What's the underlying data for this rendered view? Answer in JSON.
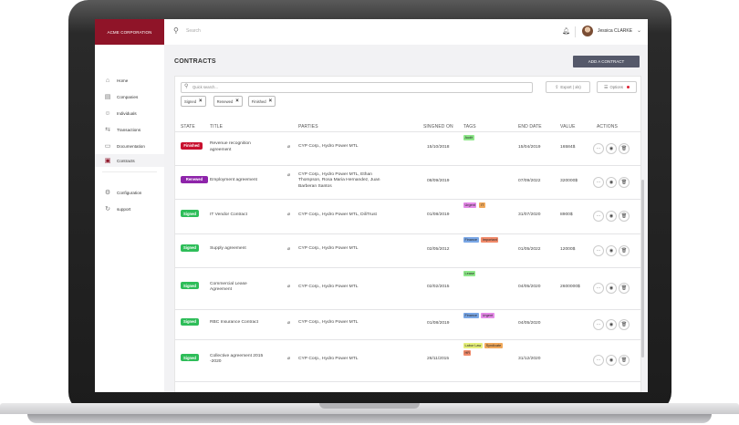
{
  "brand": "ACME CORPORATION",
  "sidebar": {
    "items": [
      {
        "label": "Home",
        "icon": "home-icon",
        "glyph": "⌂"
      },
      {
        "label": "Companies",
        "icon": "building-icon",
        "glyph": "▤"
      },
      {
        "label": "Individuals",
        "icon": "people-icon",
        "glyph": "☺"
      },
      {
        "label": "Transactions",
        "icon": "exchange-icon",
        "glyph": "⇆"
      },
      {
        "label": "Documentation",
        "icon": "folder-icon",
        "glyph": "▭"
      },
      {
        "label": "Contracts",
        "icon": "contract-icon",
        "glyph": "▣"
      }
    ],
    "bottom": [
      {
        "label": "Configuration",
        "icon": "gears-icon",
        "glyph": "⚙"
      },
      {
        "label": "support",
        "icon": "support-icon",
        "glyph": "↻"
      }
    ]
  },
  "topbar": {
    "search_placeholder": "Search",
    "user_name": "Jessica CLARKE"
  },
  "page": {
    "title": "CONTRACTS",
    "add_button": "ADD A CONTRACT"
  },
  "filters": {
    "search_placeholder": "Quick search...",
    "export_label": "Export ( xls)",
    "options_label": "Options",
    "chips": [
      "Signed",
      "Renewed",
      "Finished"
    ]
  },
  "columns": {
    "state": "STATE",
    "title": "TITLE",
    "parties": "PARTIES",
    "signed_on": "SINGNED ON",
    "tags": "TAGS",
    "end_date": "END DATE",
    "value": "VALUE",
    "actions": "ACTIONS"
  },
  "colors": {
    "brand": "#8f1428",
    "finished": "#c8102e",
    "renewed": "#8e24aa",
    "signed": "#2ebd59",
    "button": "#55596a"
  },
  "rows": [
    {
      "state": "Finished",
      "title": [
        "Revenue recognition",
        "agreement"
      ],
      "parties": [
        "CYP Corp., Hydro Power MTL"
      ],
      "signed_on": "15/10/2018",
      "tags": [
        {
          "t": "Audit",
          "c": "#8ee88a"
        }
      ],
      "end_date": "15/04/2019",
      "value": "16584$"
    },
    {
      "state": "Renewed",
      "title": [
        "Employment agreement"
      ],
      "parties": [
        "CYP Corp., Hydro Power MTL, Ethan",
        "Thompson, Rosa Maria Hernandez, Juan",
        "Barberan Santos"
      ],
      "signed_on": "08/09/2019",
      "tags": [],
      "end_date": "07/09/2022",
      "value": "320000$"
    },
    {
      "state": "Signed",
      "title": [
        "IT Vendor Contract"
      ],
      "parties": [
        "CYP Corp., Hydro Power MTL, DiliTrust"
      ],
      "signed_on": "01/08/2019",
      "tags": [
        {
          "t": "Urgent",
          "c": "#e58ae8"
        },
        {
          "t": "IT",
          "c": "#f0a85a"
        }
      ],
      "end_date": "31/07/2020",
      "value": "8900$"
    },
    {
      "state": "Signed",
      "title": [
        "Supply agreement"
      ],
      "parties": [
        "CYP Corp., Hydro Power MTL"
      ],
      "signed_on": "02/05/2012",
      "tags": [
        {
          "t": "Finance",
          "c": "#7aa7e6"
        },
        {
          "t": "Important",
          "c": "#f08a6a"
        }
      ],
      "end_date": "01/05/2022",
      "value": "12000$"
    },
    {
      "state": "Signed",
      "title": [
        "Commercial Lease",
        "Agreement"
      ],
      "parties": [
        "CYP Corp., Hydro Power MTL"
      ],
      "signed_on": "02/02/2015",
      "tags": [
        {
          "t": "Lease",
          "c": "#8ee88a"
        }
      ],
      "end_date": "04/05/2020",
      "value": "2600000$"
    },
    {
      "state": "Signed",
      "title": [
        "RBC Insurance Contract"
      ],
      "parties": [
        "CYP Corp., Hydro Power MTL"
      ],
      "signed_on": "01/08/2019",
      "tags": [
        {
          "t": "Finance",
          "c": "#7aa7e6"
        },
        {
          "t": "Urgent",
          "c": "#e58ae8"
        }
      ],
      "end_date": "04/05/2020",
      "value": ""
    },
    {
      "state": "Signed",
      "title": [
        "Collective agreement 2015",
        "-2020"
      ],
      "parties": [
        "CYP Corp., Hydro Power MTL"
      ],
      "signed_on": "26/11/2015",
      "tags": [
        {
          "t": "Labor Law",
          "c": "#e6f07a"
        },
        {
          "t": "Syndicate",
          "c": "#f0a85a"
        },
        {
          "t": "HR",
          "c": "#f08a6a"
        }
      ],
      "end_date": "31/12/2020",
      "value": ""
    }
  ]
}
